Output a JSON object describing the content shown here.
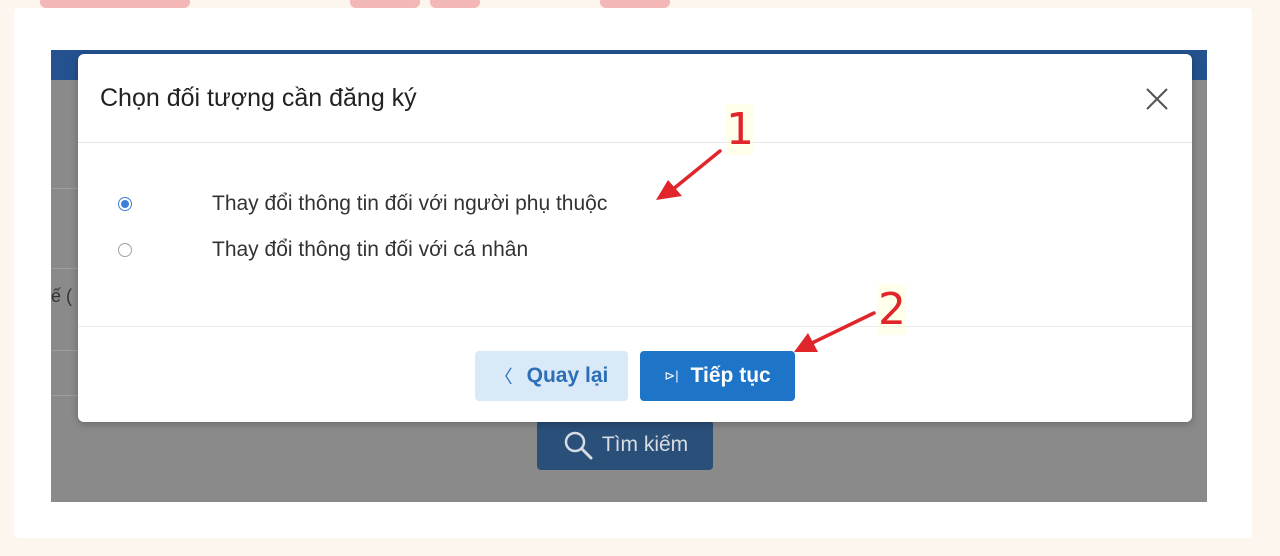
{
  "background": {
    "search_button_label": "Tìm kiếm",
    "partial_text": "ế ("
  },
  "dialog": {
    "title": "Chọn đối tượng cần đăng ký",
    "options": [
      {
        "label": "Thay đổi thông tin đối với người phụ thuộc",
        "selected": true
      },
      {
        "label": "Thay đổi thông tin đối với cá nhân",
        "selected": false
      }
    ],
    "back_label": "Quay lại",
    "next_label": "Tiếp tục",
    "back_icon": "〈",
    "next_icon": "⊳|"
  },
  "annotations": {
    "step1": "1",
    "step2": "2"
  },
  "colors": {
    "primary": "#1e74c7",
    "secondary_bg": "#d9e9f8",
    "annotation": "#e0262b",
    "nav": "#23528e"
  }
}
